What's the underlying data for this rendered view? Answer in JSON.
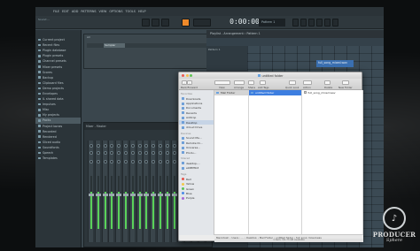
{
  "fl": {
    "menu": [
      "FILE",
      "EDIT",
      "ADD",
      "PATTERNS",
      "VIEW",
      "OPTIONS",
      "TOOLS",
      "HELP"
    ],
    "time": "0:00:00",
    "pattern": "Pattern 1",
    "panel_label": "Sound ...",
    "browser": {
      "items": [
        "Current project",
        "Recent files",
        "Plugin database",
        "Plugin presets",
        "Channel presets",
        "Mixer presets",
        "Scores",
        "Backup",
        "Clipboard files",
        "Demo projects",
        "Envelopes",
        "IL shared data",
        "Impulses",
        "Misc",
        "My projects",
        "Packs",
        "Project bones",
        "Recorded",
        "Rendered",
        "Sliced audio",
        "Soundfonts",
        "Speech",
        "Templates"
      ],
      "selected": "Packs"
    },
    "channel_rack": {
      "title": "All",
      "channel": "Sampler"
    },
    "playlist": {
      "title": "Playlist - Arrangement › Pattern 1",
      "track": "Pattern 1",
      "clip": "full_song_mixed.wav"
    },
    "mixer": {
      "title": "Mixer - Master"
    }
  },
  "finder": {
    "title": "untitled folder",
    "toolbar": {
      "back_forward": "Back/Forward",
      "view": "View",
      "arrange": "Arrange",
      "share": "Share",
      "add_tags": "Add Tags",
      "quick_look": "Quick Look",
      "action": "Action",
      "delete": "Delete",
      "new_folder": "New Folder"
    },
    "sidebar": {
      "favorites_header": "Favorites",
      "favorites": [
        "Downloads",
        "Applications",
        "Documents",
        "Recents",
        "AirDrop",
        "Desktop",
        "iCloud Drive"
      ],
      "selected": "Desktop",
      "devices_header": "Devices",
      "devices": [
        "Sound Ma...",
        "Remote Di...",
        "Universa...",
        "Produ..."
      ],
      "shared_header": "Shared",
      "shared": [
        "desktop-...",
        "eb88f3b3"
      ],
      "tags_header": "Tags",
      "tags": [
        {
          "name": "Red",
          "color": "#e5534b"
        },
        {
          "name": "Yellow",
          "color": "#f3c94a"
        },
        {
          "name": "Green",
          "color": "#5ac25a"
        },
        {
          "name": "Blue",
          "color": "#4a8ae8"
        },
        {
          "name": "Purple",
          "color": "#a769d6"
        }
      ]
    },
    "col1": [
      "Mail Folder"
    ],
    "col2": [
      "untitled folder"
    ],
    "col3": [
      "full_song_mixed.wav"
    ],
    "path": [
      "Macintosh",
      "Users",
      "...",
      "Desktop",
      "Mail Folder",
      "untitled folder",
      "full_song_mixed.wav"
    ],
    "status": "1 item, 3/1.73 GB available"
  },
  "watermark": {
    "line1": "PRODUCER",
    "line2": "Sphere"
  }
}
